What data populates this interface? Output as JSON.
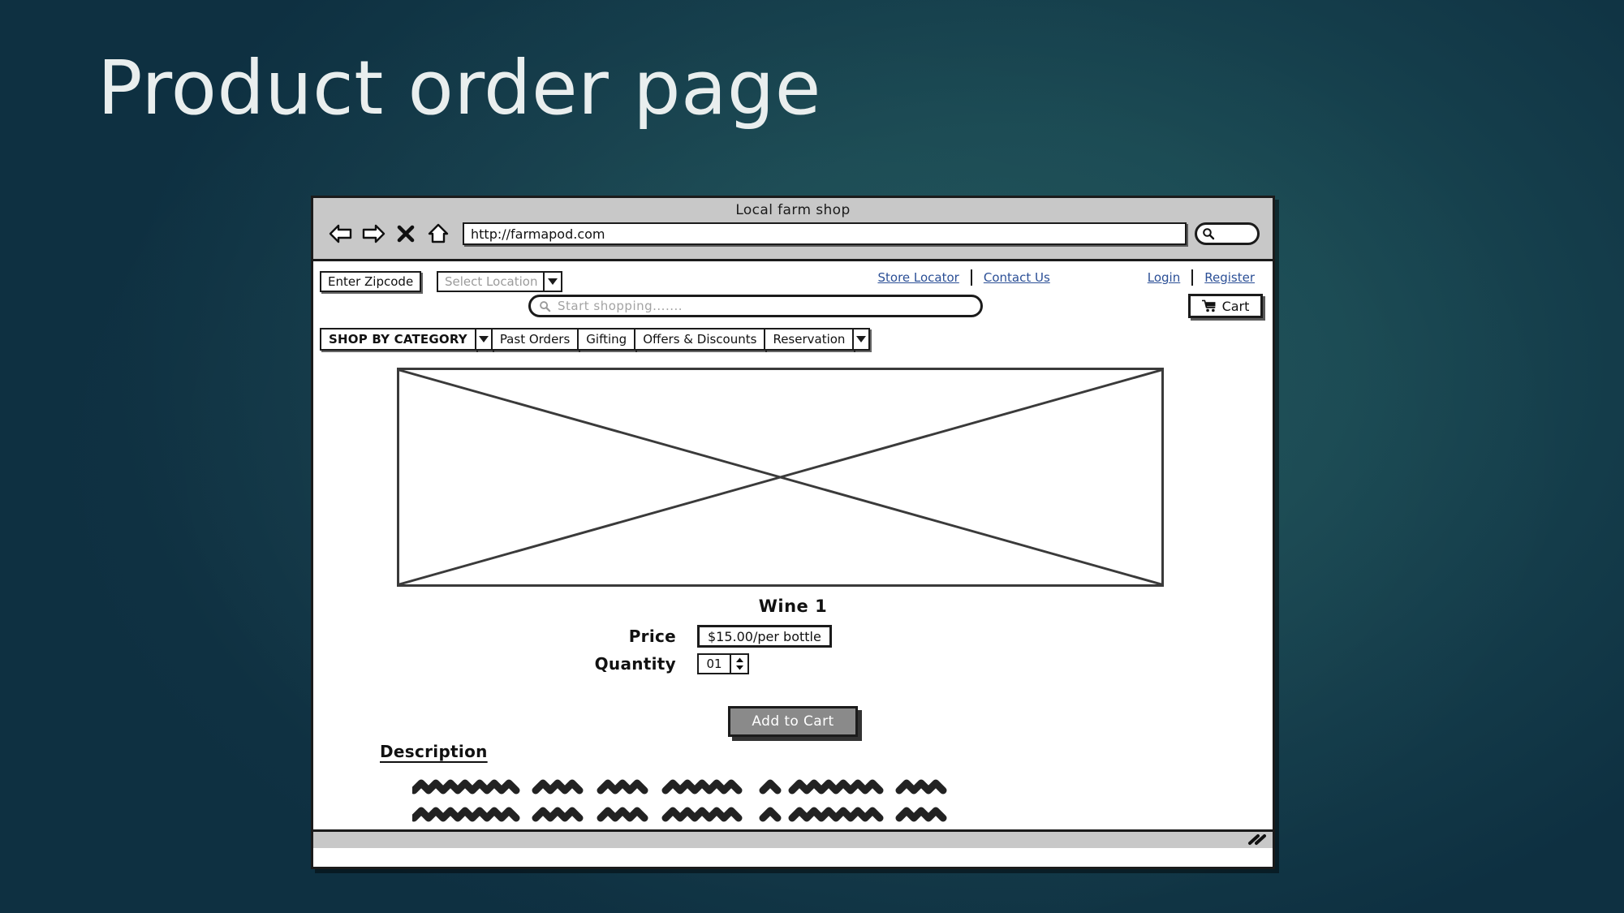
{
  "slide": {
    "title": "Product order page",
    "background_top_left": "#0c2b3c",
    "background_center": "#1e5359",
    "title_color": "#e9eeee"
  },
  "browser": {
    "window_title": "Local farm shop",
    "url": "http://farmapod.com",
    "nav_buttons": [
      {
        "name": "back-button",
        "icon": "left-arrow-icon"
      },
      {
        "name": "forward-button",
        "icon": "right-arrow-icon"
      },
      {
        "name": "stop-button",
        "icon": "close-x-icon"
      },
      {
        "name": "home-button",
        "icon": "home-icon"
      }
    ],
    "chrome_search_icon": "search-icon"
  },
  "site": {
    "zipcode_field": {
      "value": "Enter Zipcode"
    },
    "location_select": {
      "value": "Select Location",
      "icon": "chevron-down-icon"
    },
    "top_links": [
      {
        "label": "Store Locator"
      },
      {
        "label": "Contact Us"
      },
      {
        "label": "Login"
      },
      {
        "label": "Register"
      }
    ],
    "shop_search": {
      "placeholder": "Start shopping.......",
      "icon": "search-icon"
    },
    "cart_button": {
      "label": "Cart",
      "icon": "shopping-cart-icon"
    },
    "menu": [
      {
        "label": "SHOP BY CATEGORY",
        "bold": true,
        "dropdown": true
      },
      {
        "label": "Past Orders",
        "bold": false,
        "dropdown": false
      },
      {
        "label": "Gifting",
        "bold": false,
        "dropdown": false
      },
      {
        "label": "Offers & Discounts",
        "bold": false,
        "dropdown": false
      },
      {
        "label": "Reservation",
        "bold": false,
        "dropdown": true
      }
    ]
  },
  "product": {
    "image_placeholder": "crossed-box-image-placeholder",
    "name": "Wine 1",
    "price_label": "Price",
    "price_value": "$15.00/per bottle",
    "quantity_label": "Quantity",
    "quantity_value": "01",
    "quantity_stepper_icon": "up-down-spinner-icon",
    "add_to_cart_label": "Add to Cart",
    "description_title": "Description",
    "description_body_placeholder": "scribble-placeholder-text",
    "description_line_count": 3
  },
  "statusbar": {
    "resize_grip_icon": "resize-grip-icon"
  }
}
